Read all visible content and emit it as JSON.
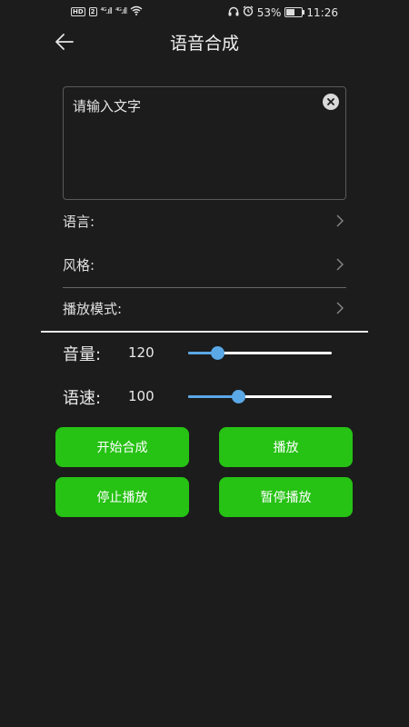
{
  "status_bar": {
    "hd_badge": "HD",
    "sim_number": "2",
    "signal_1": "⁴ᴳ.ıll",
    "signal_2": "⁴ᴳ.ıll",
    "battery_percent": "53%",
    "battery_level": 0.53,
    "time": "11:26",
    "icons": [
      "headphones-icon",
      "alarm-icon",
      "wifi-icon",
      "battery-charging-icon"
    ]
  },
  "header": {
    "title": "语音合成",
    "back_icon": "arrow-left-icon"
  },
  "text_input": {
    "placeholder": "请输入文字",
    "value": "",
    "clear_icon": "clear-circle-icon"
  },
  "settings": {
    "language_label": "语言:",
    "style_label": "风格:",
    "play_mode_label": "播放模式:",
    "chevron_icon": "chevron-right-icon"
  },
  "sliders": {
    "volume": {
      "label": "音量:",
      "value": "120",
      "fraction": 0.2
    },
    "speed": {
      "label": "语速:",
      "value": "100",
      "fraction": 0.35
    }
  },
  "buttons": {
    "start_synthesis": "开始合成",
    "play": "播放",
    "stop_play": "停止播放",
    "pause_play": "暂停播放"
  },
  "colors": {
    "background": "#1c1c1c",
    "button_green": "#26c214",
    "slider_blue": "#5aa8e6"
  }
}
